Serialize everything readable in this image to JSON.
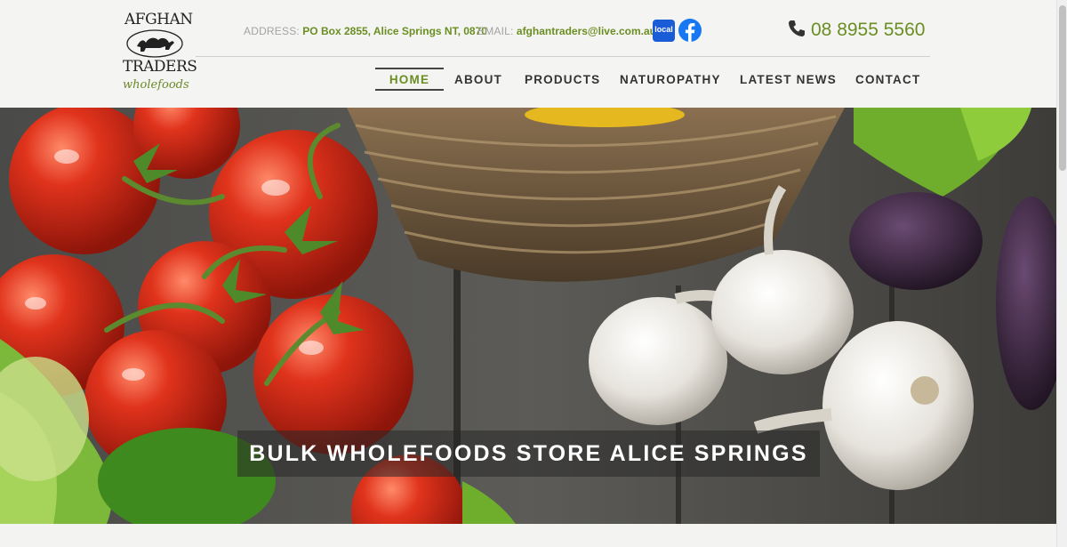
{
  "logo": {
    "line1": "AFGHAN",
    "line2": "TRADERS",
    "line3": "wholefoods",
    "icon": "camel-logo-icon"
  },
  "header": {
    "address_label": "ADDRESS:",
    "address_value": "PO Box 2855, Alice Springs NT, 0870",
    "email_label": "EMAIL:",
    "email_value": "afghantraders@live.com.au",
    "local_badge": "local",
    "phone": "08 8955 5560"
  },
  "nav": {
    "items": [
      {
        "label": "HOME",
        "active": true
      },
      {
        "label": "ABOUT",
        "active": false
      },
      {
        "label": "PRODUCTS",
        "active": false
      },
      {
        "label": "NATUROPATHY",
        "active": false
      },
      {
        "label": "LATEST NEWS",
        "active": false
      },
      {
        "label": "CONTACT",
        "active": false
      }
    ]
  },
  "hero": {
    "caption": "BULK WHOLEFOODS STORE ALICE SPRINGS"
  },
  "colors": {
    "accent": "#6b8e23",
    "nav_text": "#333333",
    "facebook": "#1877f2",
    "local_badge": "#1a5bd6"
  }
}
